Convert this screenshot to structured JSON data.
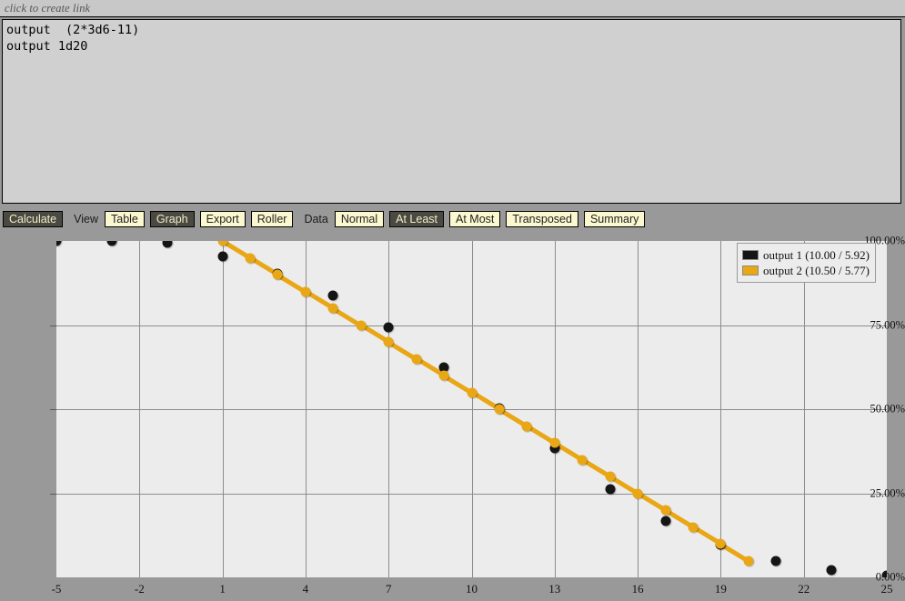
{
  "link_bar": {
    "text": "click to create link"
  },
  "output_panel": {
    "text": "output  (2*3d6-11)\noutput 1d20"
  },
  "toolbar": {
    "calculate_label": "Calculate",
    "view_label": "View",
    "view_buttons": [
      {
        "label": "Table",
        "active": false
      },
      {
        "label": "Graph",
        "active": true
      },
      {
        "label": "Export",
        "active": false
      },
      {
        "label": "Roller",
        "active": false
      }
    ],
    "data_label": "Data",
    "data_buttons": [
      {
        "label": "Normal",
        "active": false
      },
      {
        "label": "At Least",
        "active": true
      },
      {
        "label": "At Most",
        "active": false
      },
      {
        "label": "Transposed",
        "active": false
      },
      {
        "label": "Summary",
        "active": false
      }
    ]
  },
  "colors": {
    "series1": "#151515",
    "series2": "#e9a615",
    "plot_bg": "#ececec",
    "page_bg": "#999999",
    "button_active_bg": "#4a4a42",
    "button_idle_bg": "#fbf7cf"
  },
  "chart_data": {
    "type": "scatter",
    "title": "",
    "xlabel": "",
    "ylabel": "",
    "xlim": [
      -5,
      25
    ],
    "ylim": [
      0,
      1
    ],
    "grid": true,
    "legend_position": "top-right",
    "y_ticks": [
      {
        "value": 1.0,
        "label": "100.00%"
      },
      {
        "value": 0.75,
        "label": "75.00%"
      },
      {
        "value": 0.5,
        "label": "50.00%"
      },
      {
        "value": 0.25,
        "label": "25.00%"
      },
      {
        "value": 0.0,
        "label": "0.00%"
      }
    ],
    "x_ticks": [
      {
        "value": -5,
        "label": "-5"
      },
      {
        "value": -2,
        "label": "-2"
      },
      {
        "value": 1,
        "label": "1"
      },
      {
        "value": 4,
        "label": "4"
      },
      {
        "value": 7,
        "label": "7"
      },
      {
        "value": 10,
        "label": "10"
      },
      {
        "value": 13,
        "label": "13"
      },
      {
        "value": 16,
        "label": "16"
      },
      {
        "value": 19,
        "label": "19"
      },
      {
        "value": 22,
        "label": "22"
      },
      {
        "value": 25,
        "label": "25"
      }
    ],
    "series": [
      {
        "name": "output 1 (10.00 / 5.92)",
        "legend_label": "output 1 (10.00 / 5.92)",
        "color": "#151515",
        "mean": 10.0,
        "stddev": 5.92,
        "marker": "circle",
        "line": false,
        "x": [
          -5,
          -3,
          -1,
          1,
          3,
          5,
          7,
          9,
          11,
          13,
          15,
          17,
          19,
          21,
          23,
          25
        ],
        "y": [
          1.0,
          1.0,
          0.995,
          0.955,
          0.902,
          0.838,
          0.742,
          0.623,
          0.503,
          0.385,
          0.261,
          0.167,
          0.098,
          0.049,
          0.021,
          0.005
        ]
      },
      {
        "name": "output 2 (10.50 / 5.77)",
        "legend_label": "output 2 (10.50 / 5.77)",
        "color": "#e9a615",
        "mean": 10.5,
        "stddev": 5.77,
        "marker": "circle",
        "line": true,
        "x": [
          1,
          2,
          3,
          4,
          5,
          6,
          7,
          8,
          9,
          10,
          11,
          12,
          13,
          14,
          15,
          16,
          17,
          18,
          19,
          20
        ],
        "y": [
          1.0,
          0.95,
          0.9,
          0.85,
          0.8,
          0.75,
          0.7,
          0.65,
          0.6,
          0.55,
          0.5,
          0.45,
          0.4,
          0.35,
          0.3,
          0.25,
          0.2,
          0.15,
          0.1,
          0.05
        ]
      }
    ]
  }
}
